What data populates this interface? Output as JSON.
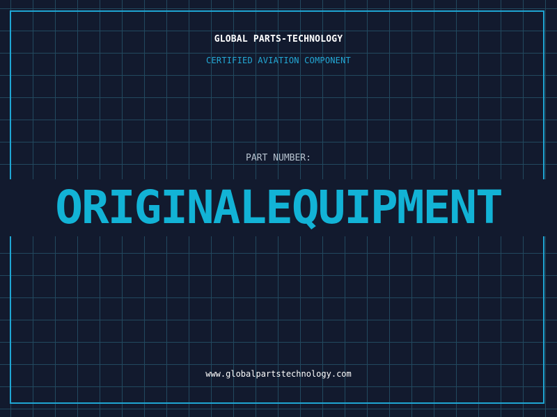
{
  "brand": "GLOBAL PARTS-TECHNOLOGY",
  "subtitle": "CERTIFIED AVIATION COMPONENT",
  "part_label": "PART NUMBER:",
  "part_number": "ORIGINALEQUIPMENT",
  "website": "www.globalpartstechnology.com",
  "colors": {
    "background": "#121a2e",
    "grid_line": "#22495f",
    "accent": "#1fa6d3",
    "part_number": "#12b3d6"
  }
}
